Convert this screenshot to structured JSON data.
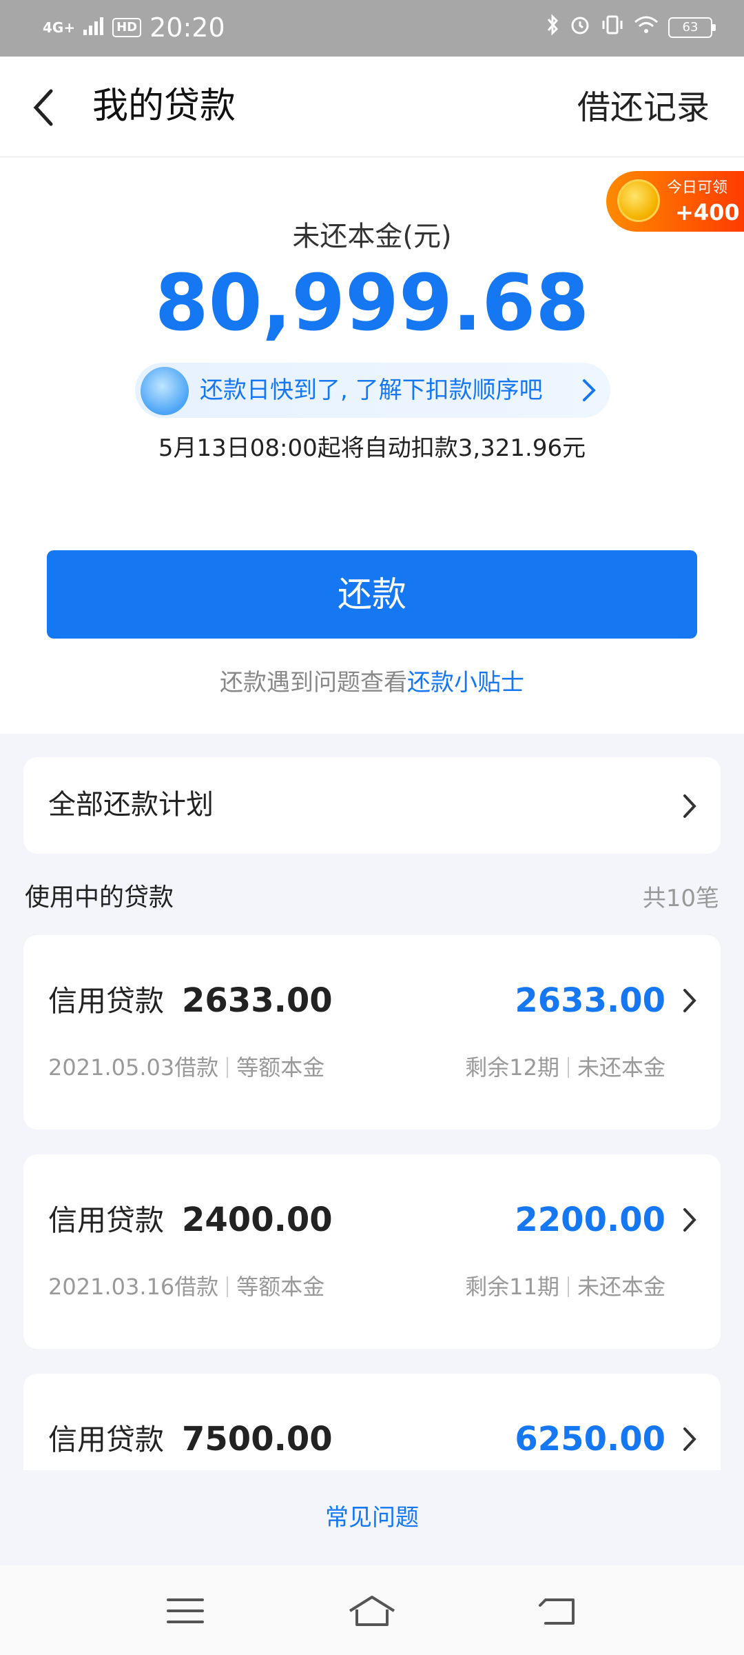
{
  "status_bar": {
    "network": "4G+",
    "hd": "HD",
    "time": "20:20",
    "battery": "63"
  },
  "header": {
    "title": "我的贷款",
    "history_link": "借还记录"
  },
  "reward": {
    "label": "今日可领",
    "value": "+400"
  },
  "summary": {
    "principal_label": "未还本金(元)",
    "principal_amount": "80,999.68",
    "notice": "还款日快到了, 了解下扣款顺序吧",
    "auto_debit": "5月13日08:00起将自动扣款3,321.96元"
  },
  "repay_button": "还款",
  "tips": {
    "prefix": "还款遇到问题查看",
    "link": "还款小贴士"
  },
  "plan": {
    "label": "全部还款计划"
  },
  "loans_section": {
    "title": "使用中的贷款",
    "count": "共10笔"
  },
  "loans": [
    {
      "type": "信用贷款",
      "amount": "2633.00",
      "remaining": "2633.00",
      "date": "2021.05.03借款",
      "method": "等额本金",
      "periods": "剩余12期",
      "remaining_label": "未还本金"
    },
    {
      "type": "信用贷款",
      "amount": "2400.00",
      "remaining": "2200.00",
      "date": "2021.03.16借款",
      "method": "等额本金",
      "periods": "剩余11期",
      "remaining_label": "未还本金"
    },
    {
      "type": "信用贷款",
      "amount": "7500.00",
      "remaining": "6250.00"
    }
  ],
  "faq": "常见问题",
  "colors": {
    "accent": "#1677f2",
    "reward_start": "#ff8a00",
    "reward_end": "#ff3c00"
  }
}
